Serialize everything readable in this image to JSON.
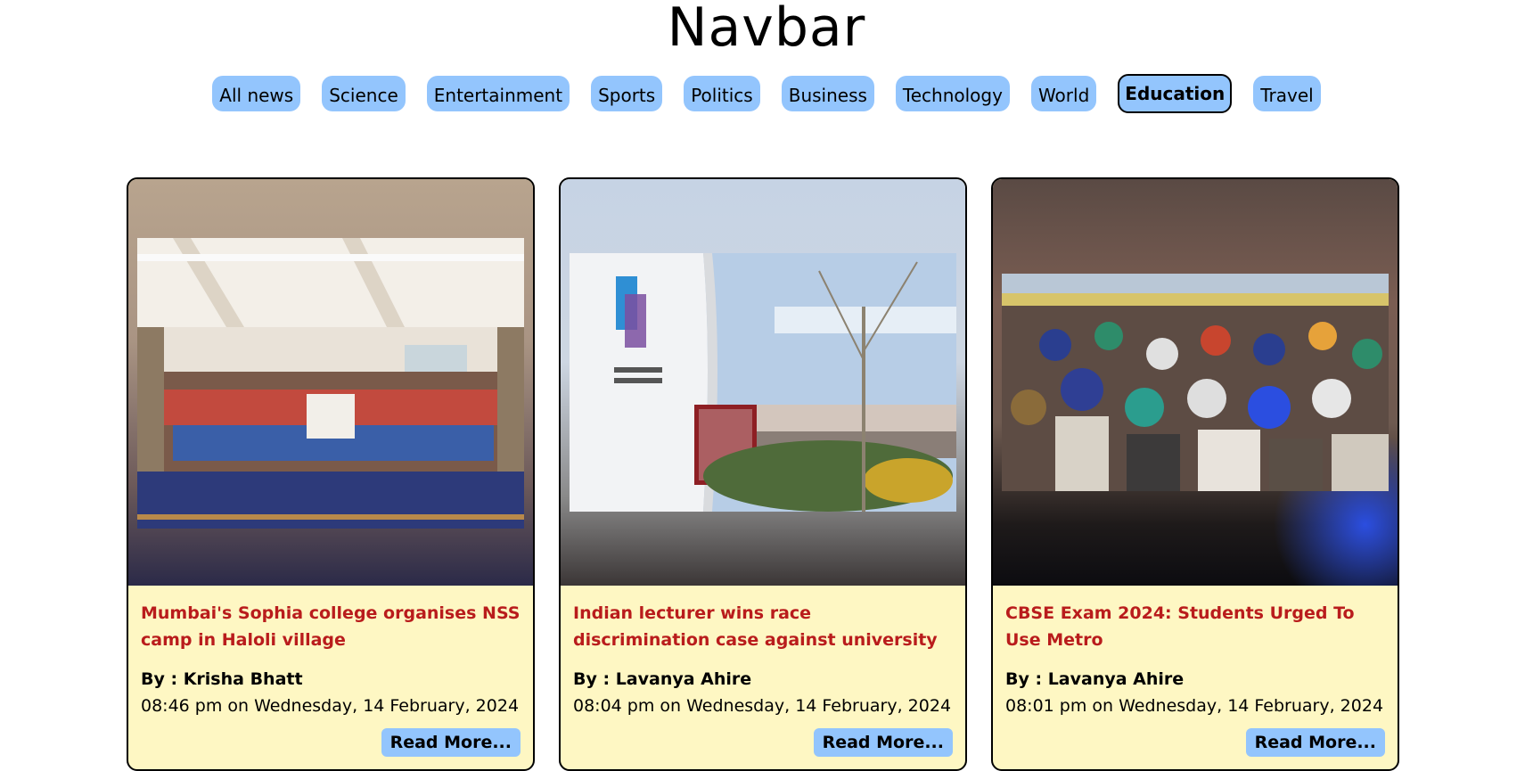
{
  "header": {
    "title": "Navbar"
  },
  "nav": {
    "items": [
      {
        "label": "All news"
      },
      {
        "label": "Science"
      },
      {
        "label": "Entertainment"
      },
      {
        "label": "Sports"
      },
      {
        "label": "Politics"
      },
      {
        "label": "Business"
      },
      {
        "label": "Technology"
      },
      {
        "label": "World"
      },
      {
        "label": "Education"
      },
      {
        "label": "Travel"
      }
    ],
    "active": "Education"
  },
  "cards": [
    {
      "title": "Mumbai's Sophia college organises NSS camp in Haloli village",
      "author": "By : Krisha Bhatt",
      "date": "08:46 pm on Wednesday, 14 February, 2024",
      "read_more": "Read More..."
    },
    {
      "title": "Indian lecturer wins race discrimination case against university",
      "author": "By : Lavanya Ahire",
      "date": "08:04 pm on Wednesday, 14 February, 2024",
      "read_more": "Read More..."
    },
    {
      "title": "CBSE Exam 2024: Students Urged To Use Metro",
      "author": "By : Lavanya Ahire",
      "date": "08:01 pm on Wednesday, 14 February, 2024",
      "read_more": "Read More..."
    }
  ],
  "colors": {
    "nav_button": "#93c5fd",
    "card_body": "#fef7c3",
    "card_title": "#b91c1c"
  }
}
